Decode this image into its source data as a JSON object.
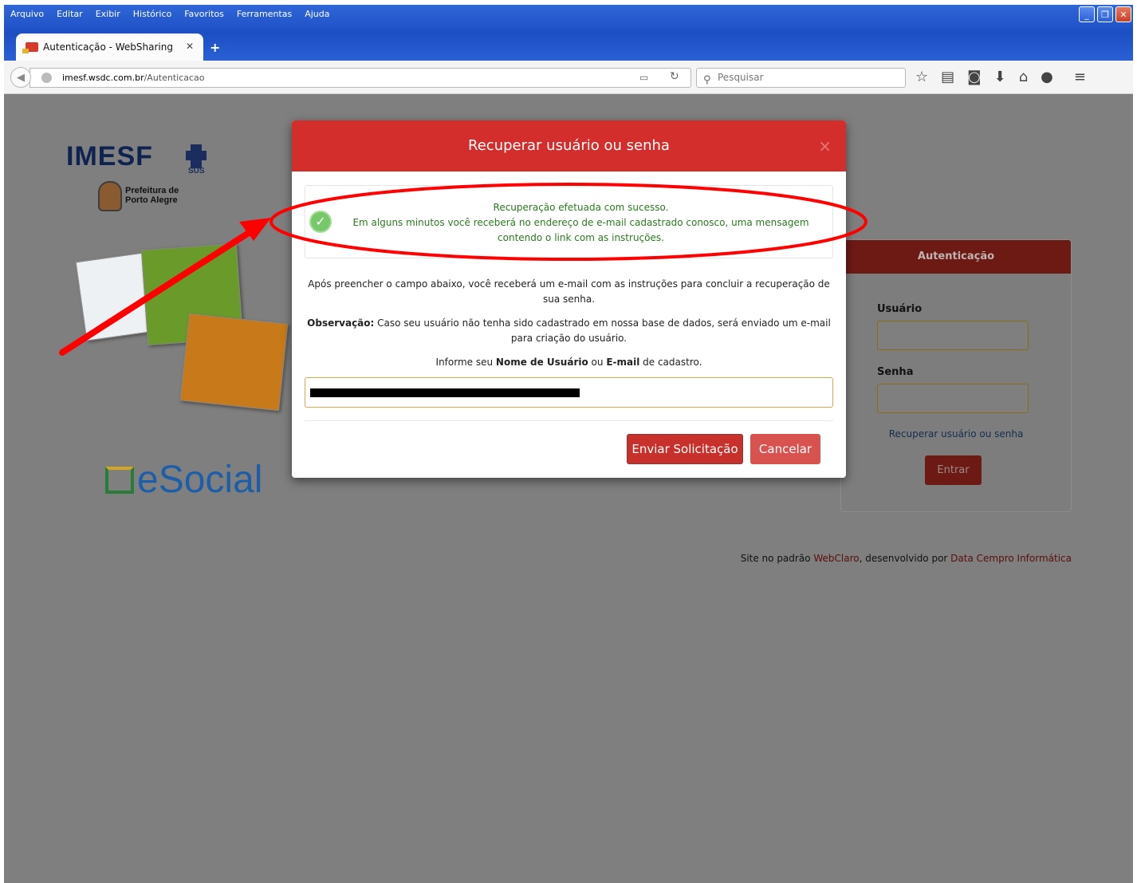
{
  "browser": {
    "menu": [
      "Arquivo",
      "Editar",
      "Exibir",
      "Histórico",
      "Favoritos",
      "Ferramentas",
      "Ajuda"
    ],
    "tab_title": "Autenticação - WebSharing",
    "url_domain": "imesf.wsdc.com.br",
    "url_path": "/Autenticacao",
    "search_placeholder": "Pesquisar"
  },
  "logos": {
    "imesf": "IMESF",
    "sus": "SUS",
    "prefeitura": "Prefeitura de\nPorto Alegre",
    "esocial": "eSocial"
  },
  "auth": {
    "title": "Autenticação",
    "user_label": "Usuário",
    "password_label": "Senha",
    "recover_link": "Recuperar usuário ou senha",
    "submit": "Entrar"
  },
  "footer": {
    "prefix": "Site no padrão ",
    "link1": "WebClaro",
    "middle": ", desenvolvido por ",
    "link2": "Data Cempro Informática"
  },
  "modal": {
    "title": "Recuperar usuário ou senha",
    "close": "×",
    "success_line1": "Recuperação efetuada com sucesso.",
    "success_line2": "Em alguns minutos você receberá no endereço de e-mail cadastrado conosco, uma mensagem contendo o link com as instruções.",
    "instructions": "Após preencher o campo abaixo, você receberá um e-mail com as instruções para concluir a recuperação de sua senha.",
    "obs_label": "Observação:",
    "obs_text": " Caso seu usuário não tenha sido cadastrado em nossa base de dados, será enviado um e-mail para criação do usuário.",
    "inform_prefix": "Informe seu ",
    "inform_bold1": "Nome de Usuário",
    "inform_mid": " ou ",
    "inform_bold2": "E-mail",
    "inform_suffix": " de cadastro.",
    "send_button": "Enviar Solicitação",
    "cancel_button": "Cancelar"
  },
  "colors": {
    "modal_header": "#d42e2c",
    "success_text": "#2b7a1f",
    "annotation": "#ff0000"
  }
}
